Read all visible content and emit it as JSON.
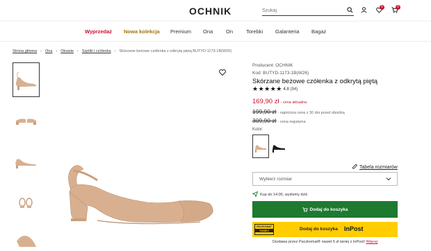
{
  "header": {
    "logo": "OCHNIK",
    "search_placeholder": "Szukaj",
    "wishlist_count": "0",
    "cart_count": "0"
  },
  "nav": [
    {
      "label": "Wyprzedaż"
    },
    {
      "label": "Nowa kolekcja"
    },
    {
      "label": "Premium"
    },
    {
      "label": "Ona"
    },
    {
      "label": "On"
    },
    {
      "label": "Torebki"
    },
    {
      "label": "Galanteria"
    },
    {
      "label": "Bagaż"
    }
  ],
  "breadcrumb": {
    "items": [
      "Strona główna",
      "Ona",
      "Obuwie",
      "Szpilki i czółenka"
    ],
    "current": "Skórzane beżowe czółenka z odkrytą piętą BUTYD-1173-1B(W26)"
  },
  "product": {
    "producer": "Producent: OCHNIK",
    "code": "Kod: BUTYD-1173-1B(W26)",
    "name": "Skórzane beżowe czółenka z odkrytą piętą",
    "stars": "★★★★★",
    "rating": "4.8",
    "reviews": "(94)",
    "price_current": "169,90 zł",
    "price_current_label": "- cena aktualna",
    "price_lowest": "199,90 zł",
    "price_lowest_label": "- najniższa cena z 30 dni przed obniżką",
    "price_regular": "309,90 zł",
    "price_regular_label": "- cena regularna",
    "color_label": "Kolor:",
    "size_chart": "Tabela rozmiarów",
    "size_placeholder": "Wybierz rozmiar",
    "shipping": "Kup do 14:00, wyślemy dziś",
    "add_to_cart": "Dodaj do koszyka",
    "inpost_badge_top": "PACZKOMAT",
    "inpost_badge_bottom": "TANIEJ",
    "inpost_button": "Dodaj do koszyka",
    "inpost_logo": "InPost",
    "delivery_text": "Dostawa przez Paczkomat® nawet 5 zł taniej z InPost!",
    "delivery_more": "Więcej"
  },
  "colors": {
    "accent_red": "#c8102e",
    "cart_green": "#1d7a2f",
    "inpost_yellow": "#ffcd00",
    "shoe_beige": "#d9b08f"
  }
}
